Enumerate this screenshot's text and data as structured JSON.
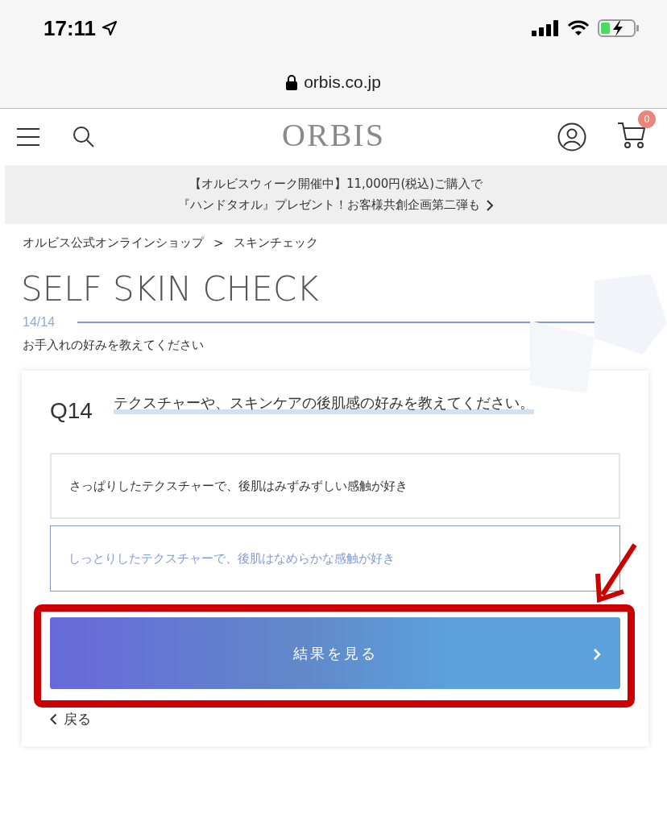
{
  "status_bar": {
    "time": "17:11"
  },
  "browser": {
    "url": "orbis.co.jp"
  },
  "header": {
    "logo": "ORBIS",
    "cart_count": "0"
  },
  "banner": {
    "lines": [
      "【オルビスウィーク開催中】11,000円(税込)ご購入で",
      "『ハンドタオル』プレゼント！お客様共創企画第二弾も"
    ]
  },
  "breadcrumb": [
    {
      "label": "オルビス公式オンラインショップ"
    },
    {
      "label": "スキンチェック"
    }
  ],
  "breadcrumb_separator": ">",
  "title": "SELF SKIN CHECK",
  "progress": {
    "label": "14/14",
    "level": 1
  },
  "section_label": "お手入れの好みを教えてください",
  "question": {
    "number": "Q14",
    "text": "テクスチャーや、スキンケアの後肌感の好みを教えてください。",
    "options": [
      {
        "label": "さっぱりしたテクスチャーで、後肌はみずみずしい感触が好き",
        "selected": false
      },
      {
        "label": "しっとりしたテクスチャーで、後肌はなめらかな感触が好き",
        "selected": true
      }
    ],
    "submit": "結果を見る",
    "back": "戻る"
  },
  "annotation": {
    "highlighted": true
  }
}
